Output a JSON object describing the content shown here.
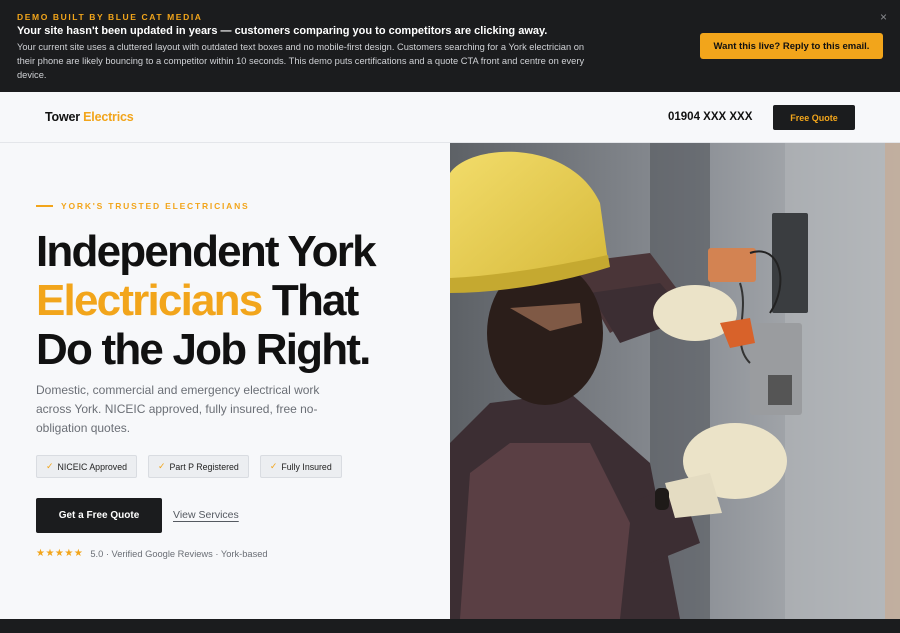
{
  "banner": {
    "eyebrow": "DEMO BUILT BY BLUE CAT MEDIA",
    "title": "Your site hasn't been updated in years — customers comparing you to competitors are clicking away.",
    "body": "Your current site uses a cluttered layout with outdated text boxes and no mobile-first design. Customers searching for a York electrician on their phone are likely bouncing to a competitor within 10 seconds. This demo puts certifications and a quote CTA front and centre on every device.",
    "cta_label": "Want this live? Reply to this email.",
    "close_glyph": "×"
  },
  "nav": {
    "logo_primary": "Tower",
    "logo_accent": "Electrics",
    "phone": "01904 XXX XXX",
    "cta_label": "Free Quote"
  },
  "hero": {
    "eyebrow": "YORK'S TRUSTED ELECTRICIANS",
    "headline_line1": "Independent York",
    "headline_accent": "Electricians",
    "headline_line2_rest": " That",
    "headline_line3": "Do the Job Right.",
    "lede": "Domestic, commercial and emergency electrical work across York. NICEIC approved, fully insured, free no-obligation quotes.",
    "badges": [
      {
        "tick": "✓",
        "label": "NICEIC Approved"
      },
      {
        "tick": "✓",
        "label": "Part P Registered"
      },
      {
        "tick": "✓",
        "label": "Fully Insured"
      }
    ],
    "cta_label": "Get a Free Quote",
    "secondary_link": "View Services",
    "rating_stars": "★★★★★",
    "rating_text": "5.0 · Verified Google Reviews · York-based"
  },
  "colors": {
    "accent": "#f2a51b",
    "dark": "#1b1c1e",
    "background": "#f7f8fa"
  },
  "icons": {
    "close": "close-icon",
    "tick": "check-icon",
    "star": "star-icon"
  }
}
